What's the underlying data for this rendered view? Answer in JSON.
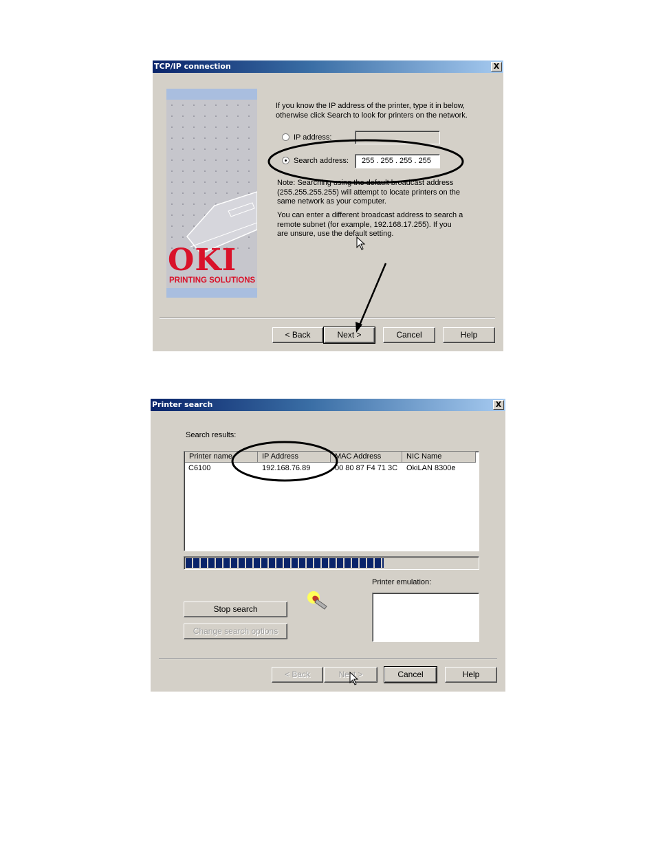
{
  "tcp_dialog": {
    "title": "TCP/IP connection",
    "close_label": "X",
    "intro": "If you know the IP address of the printer, type it in below, otherwise click Search to look for printers on the network.",
    "ip_address_label": "IP address:",
    "ip_address_value": "",
    "search_address_label": "Search address:",
    "search_address_value": "255 . 255 . 255 . 255",
    "note": "Note: Searching using the default broadcast address (255.255.255.255) will attempt to locate printers on the same network as your computer.",
    "note2": "You can enter a different broadcast address to search a remote subnet (for example, 192.168.17.255). If you are unsure, use the default setting.",
    "brand": "OKI",
    "brand_sub": "PRINTING SOLUTIONS",
    "buttons": {
      "back": "< Back",
      "next": "Next >",
      "cancel": "Cancel",
      "help": "Help"
    }
  },
  "search_dialog": {
    "title": "Printer search",
    "close_label": "X",
    "results_label": "Search results:",
    "columns": [
      "Printer name",
      "IP Address",
      "MAC Address",
      "NIC Name"
    ],
    "rows": [
      {
        "printer_name": "C6100",
        "ip": "192.168.76.89",
        "mac": "00 80 87 F4 71 3C",
        "nic": "OkiLAN 8300e"
      }
    ],
    "progress": 0.68,
    "emulation_label": "Printer emulation:",
    "stop_search": "Stop search",
    "change_options": "Change search options",
    "buttons": {
      "back": "< Back",
      "next": "Next >",
      "cancel": "Cancel",
      "help": "Help"
    }
  },
  "colors": {
    "dialog_bg": "#d4d0c8",
    "titlebar_start": "#0a246a",
    "progress_fill": "#0a246a",
    "oki_red": "#d9122a"
  }
}
